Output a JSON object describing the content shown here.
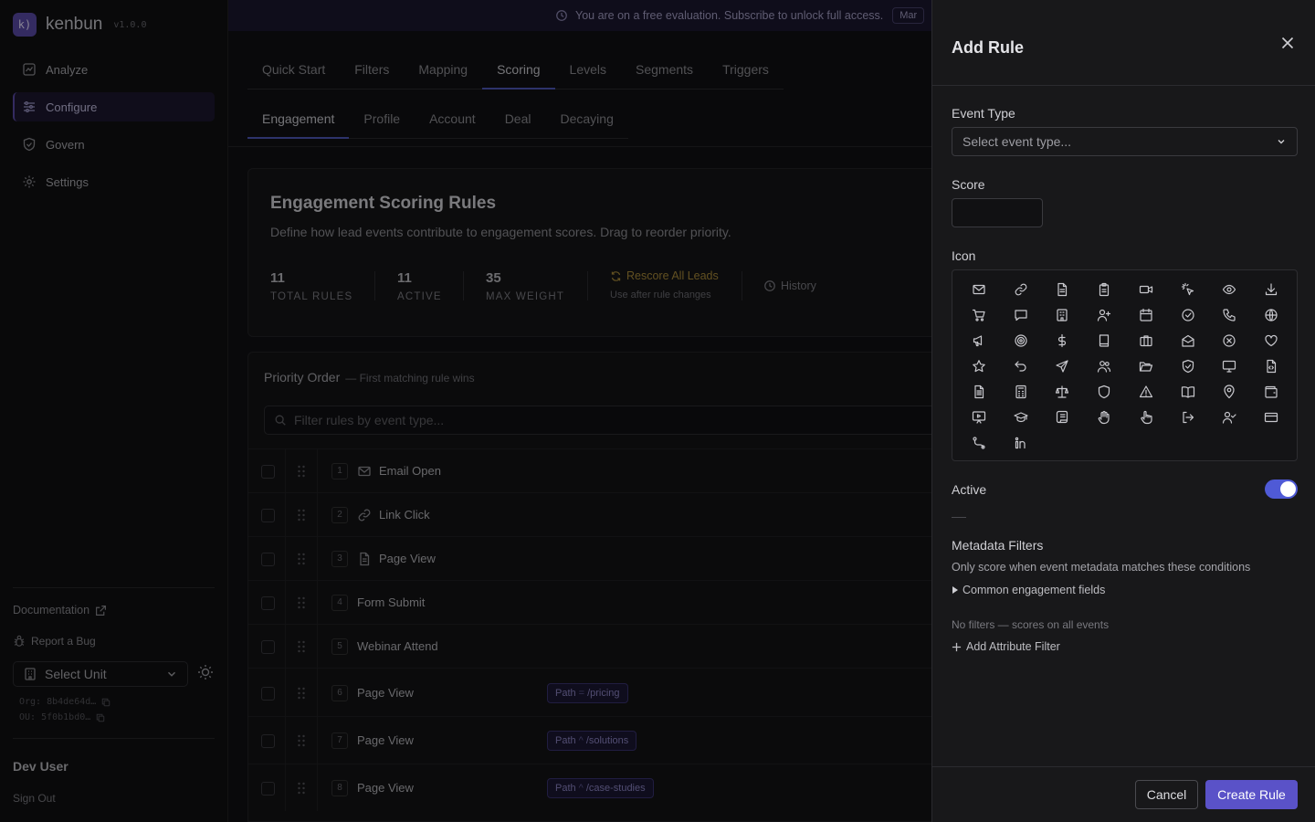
{
  "app": {
    "name": "kenbun",
    "version": "v1.0.0",
    "logo_glyph": "k)"
  },
  "sidebar": {
    "nav": [
      {
        "label": "Analyze",
        "icon": "analytics-icon"
      },
      {
        "label": "Configure",
        "icon": "sliders-icon",
        "active": true
      },
      {
        "label": "Govern",
        "icon": "shield-icon"
      },
      {
        "label": "Settings",
        "icon": "gear-icon"
      }
    ],
    "documentation": "Documentation",
    "report_bug": "Report a Bug",
    "unit_select": "Select Unit",
    "org_id": "Org: 8b4de64d…",
    "ou_id": "OU: 5f0b1bd0…",
    "user_name": "Dev User",
    "sign_out": "Sign Out"
  },
  "banner": {
    "text": "You are on a free evaluation. Subscribe to unlock full access.",
    "button": "Mar"
  },
  "tabs_primary": [
    "Quick Start",
    "Filters",
    "Mapping",
    "Scoring",
    "Levels",
    "Segments",
    "Triggers"
  ],
  "tabs_primary_active": "Scoring",
  "tabs_secondary": [
    "Engagement",
    "Profile",
    "Account",
    "Deal",
    "Decaying"
  ],
  "tabs_secondary_active": "Engagement",
  "summary": {
    "title": "Engagement Scoring Rules",
    "description": "Define how lead events contribute to engagement scores. Drag to reorder priority.",
    "stats": [
      {
        "value": "11",
        "label": "TOTAL RULES"
      },
      {
        "value": "11",
        "label": "ACTIVE"
      },
      {
        "value": "35",
        "label": "MAX WEIGHT"
      }
    ],
    "rescore_label": "Rescore All Leads",
    "rescore_hint": "Use after rule changes",
    "history_label": "History"
  },
  "priority": {
    "title": "Priority Order",
    "subtitle": "— First matching rule wins",
    "filter_placeholder": "Filter rules by event type...",
    "rows": [
      {
        "num": "1",
        "name": "Email Open",
        "icon": "mail-icon"
      },
      {
        "num": "2",
        "name": "Link Click",
        "icon": "link-icon"
      },
      {
        "num": "3",
        "name": "Page View",
        "icon": "file-icon"
      },
      {
        "num": "4",
        "name": "Form Submit",
        "icon": ""
      },
      {
        "num": "5",
        "name": "Webinar Attend",
        "icon": ""
      },
      {
        "num": "6",
        "name": "Page View",
        "icon": "",
        "filter": {
          "field": "Path",
          "op": "=",
          "value": "/pricing"
        }
      },
      {
        "num": "7",
        "name": "Page View",
        "icon": "",
        "filter": {
          "field": "Path",
          "op": "^",
          "value": "/solutions"
        }
      },
      {
        "num": "8",
        "name": "Page View",
        "icon": "",
        "filter": {
          "field": "Path",
          "op": "^",
          "value": "/case-studies"
        }
      }
    ]
  },
  "drawer": {
    "title": "Add Rule",
    "event_type_label": "Event Type",
    "event_type_placeholder": "Select event type...",
    "score_label": "Score",
    "score_value": "",
    "icon_label": "Icon",
    "icons": [
      "mail",
      "link",
      "file-text",
      "clipboard",
      "video",
      "click",
      "eye",
      "download",
      "cart",
      "message",
      "building",
      "user-plus",
      "calendar",
      "check-circle",
      "phone",
      "globe",
      "megaphone",
      "target",
      "dollar",
      "book",
      "briefcase",
      "mail-open",
      "x-circle",
      "heart",
      "star",
      "undo",
      "send",
      "users",
      "folder-open",
      "shield-check",
      "monitor",
      "file-code",
      "file-lines",
      "calculator",
      "scale",
      "shield",
      "alert",
      "book-open",
      "map-pin",
      "wallet",
      "presentation",
      "graduation-cap",
      "scroll",
      "hand",
      "pointer",
      "log-out",
      "user-check",
      "credit-card",
      "route",
      "linkedin"
    ],
    "active_label": "Active",
    "active": true,
    "metadata_title": "Metadata Filters",
    "metadata_desc": "Only score when event metadata matches these conditions",
    "common_fields": "Common engagement fields",
    "no_filters": "No filters — scores on all events",
    "add_filter": "Add Attribute Filter",
    "cancel": "Cancel",
    "create": "Create Rule"
  }
}
